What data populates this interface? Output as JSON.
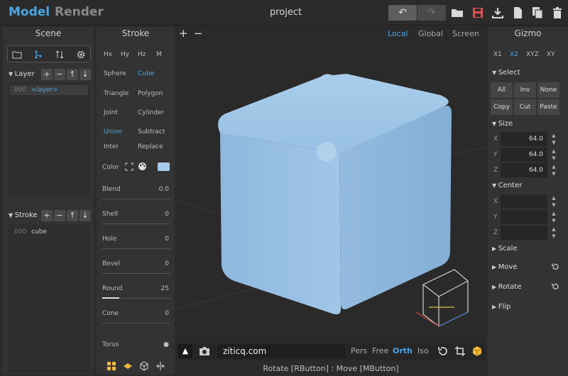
{
  "topbar": {
    "mode_model": "Model",
    "mode_render": "Render",
    "title": "project",
    "undo": "↶",
    "redo": "↷"
  },
  "scene": {
    "header": "Scene",
    "layer_section": "Layer",
    "layers": [
      {
        "index": "000",
        "name": "<layer>"
      }
    ],
    "stroke_section": "Stroke",
    "strokes": [
      {
        "index": "000",
        "name": "cube"
      }
    ],
    "buttons": {
      "add": "+",
      "remove": "−",
      "up": "↑",
      "down": "↓"
    }
  },
  "stroke": {
    "header": "Stroke",
    "symmetry": [
      "Hx",
      "Hy",
      "Hz",
      "M"
    ],
    "primitives": [
      "Sphere",
      "Cube",
      "Triangle",
      "Polygon",
      "Joint",
      "Cylinder"
    ],
    "selected_primitive": "Cube",
    "ops": [
      "Union",
      "Subtract",
      "Inter",
      "Replace"
    ],
    "selected_op": "Union",
    "color_label": "Color",
    "color_swatch": "#a9cbe9",
    "params": [
      {
        "label": "Blend",
        "value": "0.0"
      },
      {
        "label": "Shell",
        "value": "0"
      },
      {
        "label": "Hole",
        "value": "0"
      },
      {
        "label": "Bevel",
        "value": "0"
      },
      {
        "label": "Round",
        "value": "25"
      },
      {
        "label": "Cone",
        "value": "0"
      },
      {
        "label": "Torus",
        "value": ""
      }
    ],
    "round_fill": 0.25
  },
  "viewport": {
    "zoom_in": "+",
    "zoom_out": "−",
    "space_modes": [
      "Local",
      "Global",
      "Screen"
    ],
    "selected_space": "Local",
    "url_text": "ziticq.com",
    "projection_modes": [
      "Pers",
      "Free",
      "Orth",
      "Iso"
    ],
    "selected_projection": "Orth",
    "object_color": "#a5c9e8"
  },
  "status": "Rotate [RButton] : Move [MButton]",
  "gizmo": {
    "header": "Gizmo",
    "axis_modes": [
      "X1",
      "X2",
      "XYZ",
      "XY"
    ],
    "selected_axis": "X2",
    "select_section": "Select",
    "select_buttons": [
      "All",
      "Inv",
      "None",
      "Copy",
      "Cut",
      "Paste"
    ],
    "size_section": "Size",
    "size": [
      {
        "axis": "X",
        "value": "64.0"
      },
      {
        "axis": "Y",
        "value": "64.0"
      },
      {
        "axis": "Z",
        "value": "64.0"
      }
    ],
    "center_section": "Center",
    "center": [
      {
        "axis": "X",
        "value": ""
      },
      {
        "axis": "Y",
        "value": ""
      },
      {
        "axis": "Z",
        "value": ""
      }
    ],
    "scale_section": "Scale",
    "move_section": "Move",
    "rotate_section": "Rotate",
    "flip_section": "Flip"
  },
  "colors": {
    "accent": "#4ca6e6",
    "save": "#e05050"
  }
}
